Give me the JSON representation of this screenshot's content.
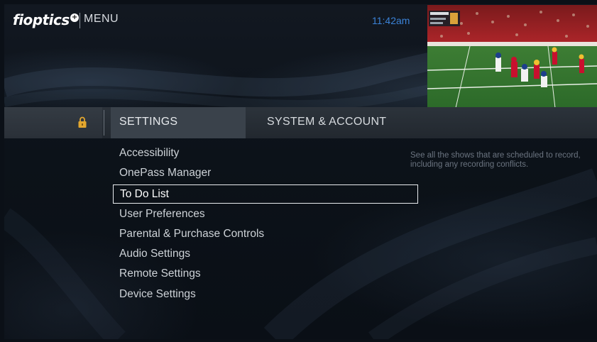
{
  "header": {
    "brand": "fioptics",
    "brand_mark": "+",
    "title": "MENU",
    "clock": "11:42am"
  },
  "tabs": [
    {
      "label": "SETTINGS",
      "active": true
    },
    {
      "label": "SYSTEM & ACCOUNT",
      "active": false
    }
  ],
  "menu": {
    "items": [
      {
        "label": "Accessibility"
      },
      {
        "label": "OnePass Manager"
      },
      {
        "label": "To Do List",
        "selected": true
      },
      {
        "label": "User Preferences"
      },
      {
        "label": "Parental & Purchase Controls"
      },
      {
        "label": "Audio Settings"
      },
      {
        "label": "Remote Settings"
      },
      {
        "label": "Device Settings"
      }
    ]
  },
  "description": "See all the shows that are scheduled to record, including any recording conflicts.",
  "icons": {
    "lock": "lock-icon"
  },
  "colors": {
    "accent_clock": "#3b82d6",
    "lock": "#e3a72f",
    "selection_border": "#e9ecef"
  }
}
